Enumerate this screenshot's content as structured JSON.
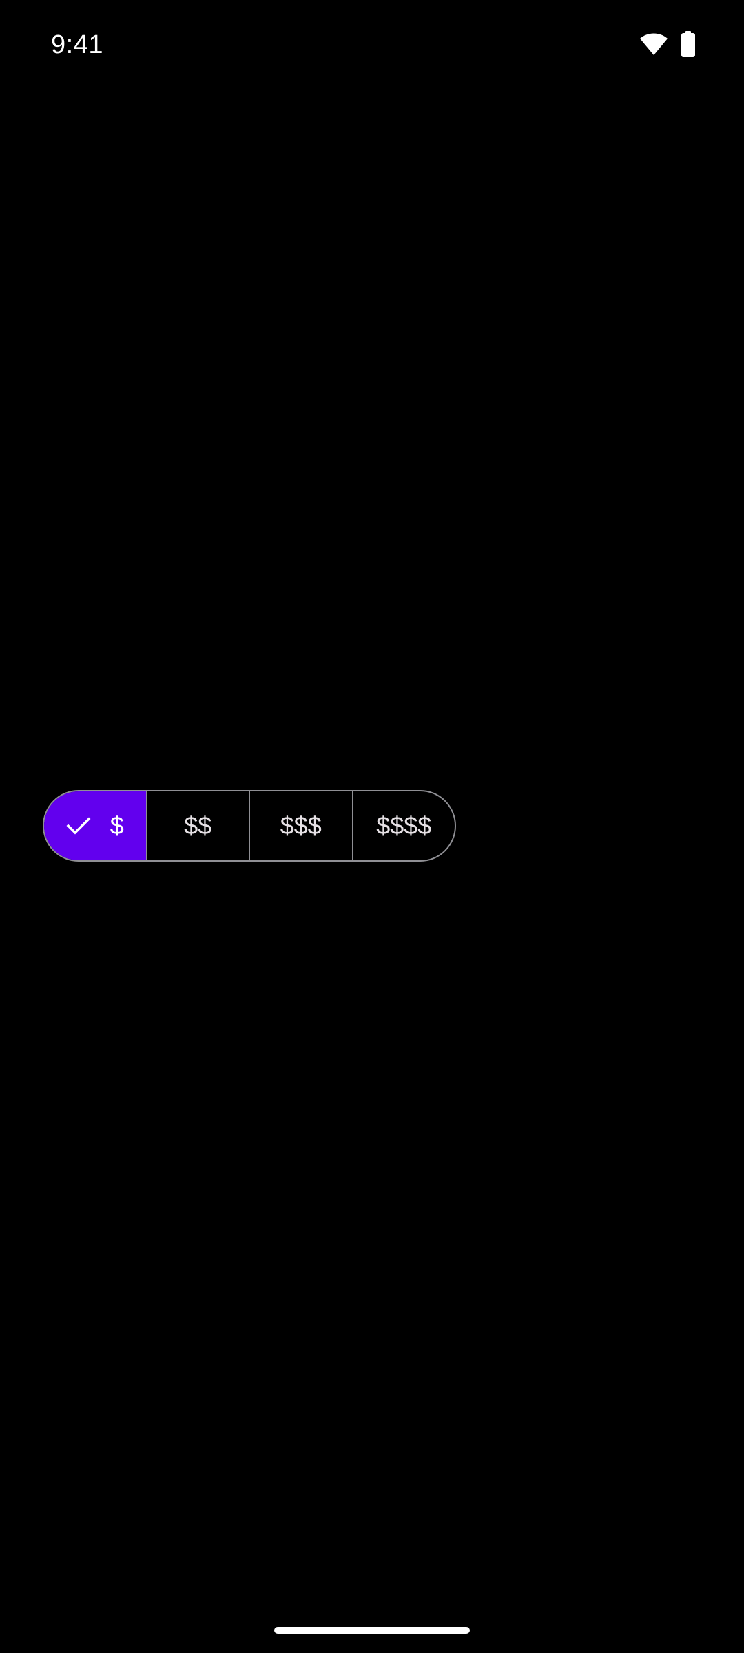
{
  "status_bar": {
    "time": "9:41",
    "icons": [
      "wifi-icon",
      "battery-icon"
    ]
  },
  "segmented_button": {
    "options": [
      {
        "label": "$",
        "selected": true
      },
      {
        "label": "$$",
        "selected": false
      },
      {
        "label": "$$$",
        "selected": false
      },
      {
        "label": "$$$$",
        "selected": false
      }
    ],
    "selected_icon": "check-icon"
  },
  "colors": {
    "background": "#000000",
    "selected": "#6200ee",
    "outline": "#8f8f94",
    "text": "#e6e1e5"
  }
}
